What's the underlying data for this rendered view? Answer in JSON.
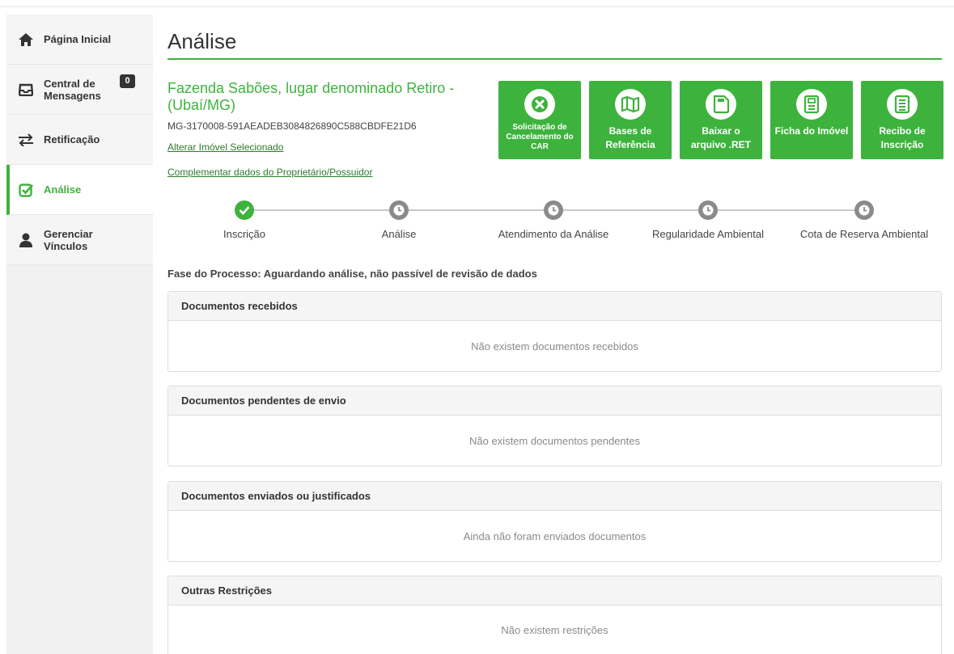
{
  "sidebar": {
    "items": [
      {
        "label": "Página Inicial",
        "icon": "home-icon"
      },
      {
        "label": "Central de Mensagens",
        "icon": "inbox-icon",
        "badge": "0"
      },
      {
        "label": "Retificação",
        "icon": "swap-arrows-icon"
      },
      {
        "label": "Análise",
        "icon": "check-square-icon",
        "active": true
      },
      {
        "label": "Gerenciar Vínculos",
        "icon": "user-icon"
      }
    ]
  },
  "main": {
    "title": "Análise",
    "property": {
      "name": "Fazenda Sabões, lugar denominado Retiro - (Ubaí/MG)",
      "code": "MG-3170008-591AEADEB3084826890C588CBDFE21D6",
      "change_link": "Alterar Imóvel Selecionado",
      "complement_link": "Complementar dados do Proprietário/Possuidor"
    },
    "actions": [
      {
        "label": "Solicitação de Cancelamento do CAR",
        "icon": "cancel-circle-icon"
      },
      {
        "label": "Bases de Referência",
        "icon": "map-icon"
      },
      {
        "label": "Baixar o arquivo .RET",
        "icon": "ret-file-icon"
      },
      {
        "label": "Ficha do Imóvel",
        "icon": "property-card-icon"
      },
      {
        "label": "Recibo de Inscrição",
        "icon": "receipt-icon"
      }
    ],
    "steps": [
      {
        "label": "Inscrição",
        "status": "done"
      },
      {
        "label": "Análise",
        "status": "pending"
      },
      {
        "label": "Atendimento da Análise",
        "status": "pending"
      },
      {
        "label": "Regularidade Ambiental",
        "status": "pending"
      },
      {
        "label": "Cota de Reserva Ambiental",
        "status": "pending"
      }
    ],
    "phase": "Fase do Processo: Aguardando análise, não passível de revisão de dados",
    "panels": [
      {
        "title": "Documentos recebidos",
        "empty": "Não existem documentos recebidos"
      },
      {
        "title": "Documentos pendentes de envio",
        "empty": "Não existem documentos pendentes"
      },
      {
        "title": "Documentos enviados ou justificados",
        "empty": "Ainda não foram enviados documentos"
      },
      {
        "title": "Outras Restrições",
        "empty": "Não existem restrições"
      }
    ]
  },
  "colors": {
    "accent": "#3db33d",
    "pending": "#8a8a8a"
  }
}
